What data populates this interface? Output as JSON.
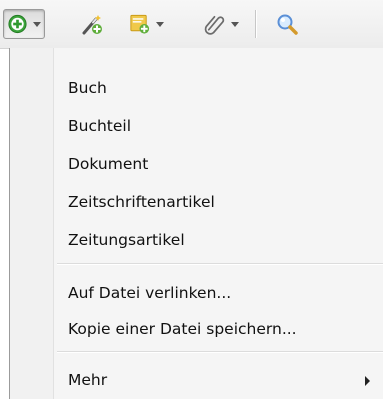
{
  "toolbar": {
    "buttons": [
      {
        "icon": "new-item-icon",
        "has_dropdown": true,
        "state": "pressed"
      },
      {
        "icon": "add-by-identifier-icon",
        "has_dropdown": false
      },
      {
        "icon": "new-note-icon",
        "has_dropdown": true
      },
      {
        "icon": "attachment-icon",
        "has_dropdown": true
      },
      {
        "icon": "search-icon",
        "has_dropdown": false
      }
    ],
    "colors": {
      "new_item_green": "#3aa33a",
      "magic_wand_green": "#5fae3b",
      "note_yellow": "#f0c94a",
      "search_blue": "#5a8fd6"
    }
  },
  "menu": {
    "item_types": [
      "Buch",
      "Buchteil",
      "Dokument",
      "Zeitschriftenartikel",
      "Zeitungsartikel"
    ],
    "file_actions": [
      "Auf Datei verlinken...",
      "Kopie einer Datei speichern..."
    ],
    "more_label": "Mehr"
  }
}
